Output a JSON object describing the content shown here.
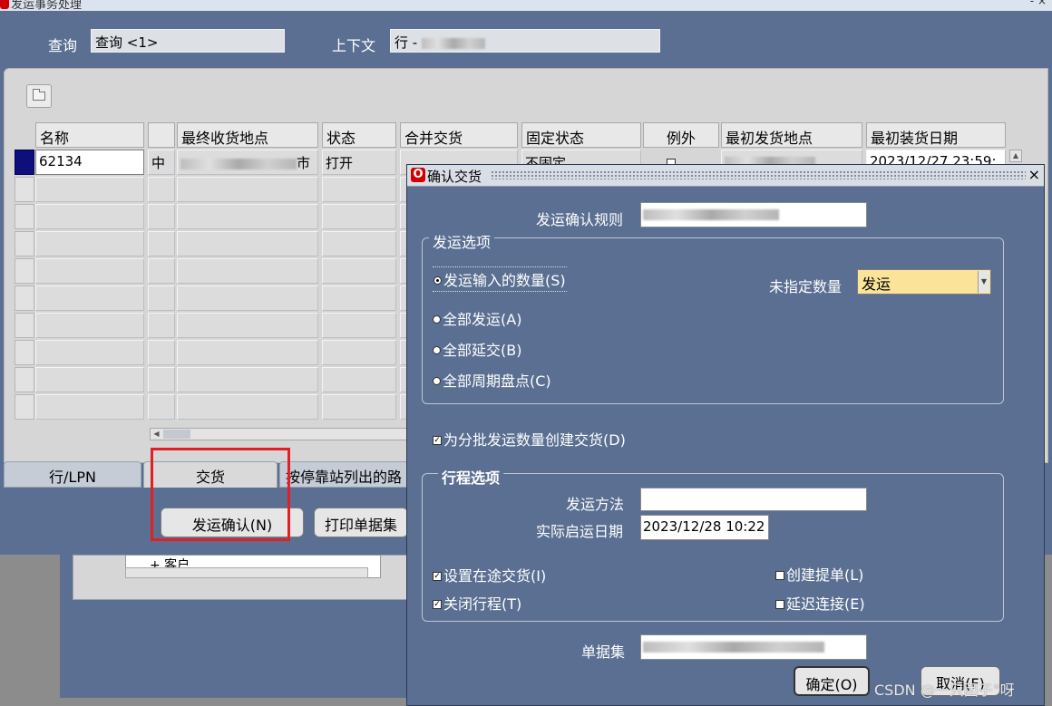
{
  "main_window": {
    "title": "发运事务处理",
    "controls": "- ×",
    "query_label": "查询",
    "query_value": "查询 <1>",
    "context_label": "上下文",
    "context_value": "行 -"
  },
  "grid": {
    "headers": [
      "名称",
      "",
      "最终收货地点",
      "状态",
      "合并交货",
      "固定状态",
      "例外",
      "最初发货地点",
      "最初装货日期"
    ],
    "row1": {
      "name": "62134",
      "col2": "中",
      "location_suffix": "市",
      "status": "打开",
      "fixed_status": "不固定",
      "first_load_date": "2023/12/27 23:59:"
    }
  },
  "tabs": [
    "行/LPN",
    "交货",
    "按停靠站列出的路"
  ],
  "buttons": {
    "ship_confirm": "发运确认(N)",
    "print_docs": "打印单据集"
  },
  "background_tree": {
    "item": "+ 客户"
  },
  "dialog": {
    "title": "确认交货",
    "close": "×",
    "rule_label": "发运确认规则",
    "ship_options_title": "发运选项",
    "options": [
      {
        "label": "发运输入的数量(S)",
        "selected": true
      },
      {
        "label": "全部发运(A)",
        "selected": false
      },
      {
        "label": "全部延交(B)",
        "selected": false
      },
      {
        "label": "全部周期盘点(C)",
        "selected": false
      }
    ],
    "unspecified_label": "未指定数量",
    "unspecified_value": "发运",
    "create_delivery_label": "为分批发运数量创建交货(D)",
    "create_delivery_checked": true,
    "trip_title": "行程选项",
    "ship_method_label": "发运方法",
    "ship_method_value": "",
    "actual_date_label": "实际启运日期",
    "actual_date_value": "2023/12/28 10:22",
    "trip_checks": [
      {
        "label": "设置在途交货(I)",
        "checked": true
      },
      {
        "label": "创建提单(L)",
        "checked": false
      },
      {
        "label": "关闭行程(T)",
        "checked": true
      },
      {
        "label": "延迟连接(E)",
        "checked": false
      }
    ],
    "doc_set_label": "单据集",
    "ok_label": "确定(O)",
    "cancel_label": "取消(F)"
  },
  "watermark": "CSDN @一只团子°呀",
  "colors": {
    "window_bg": "#5a6f92",
    "highlight": "#e31f26",
    "dropdown": "#fbe49a",
    "selected_row": "#0f0f7c"
  }
}
